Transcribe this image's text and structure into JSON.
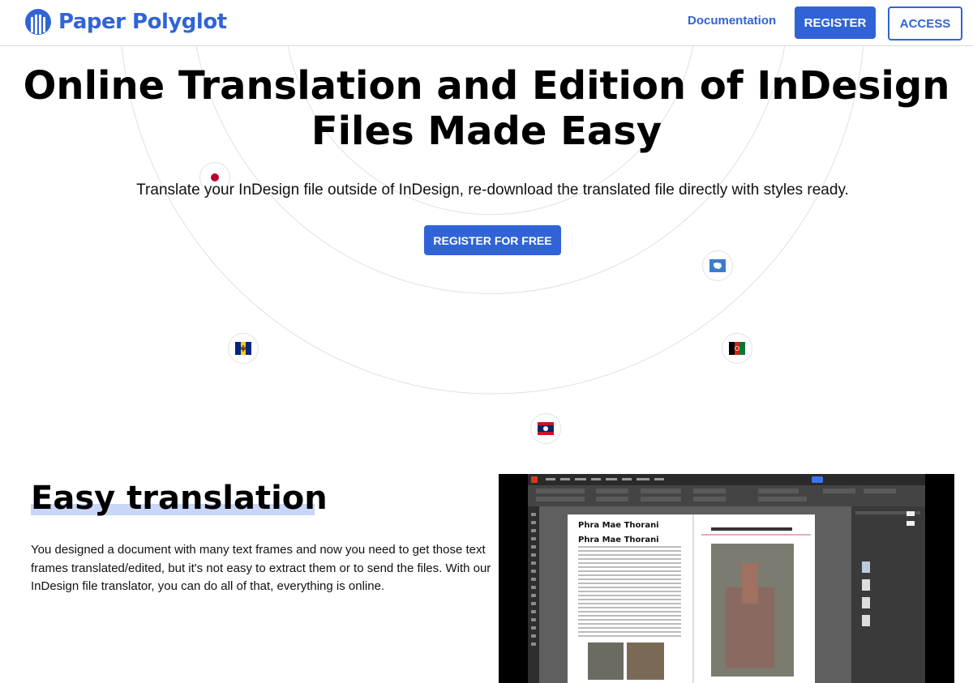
{
  "brand": {
    "name": "Paper Polyglot",
    "color": "#3064d6"
  },
  "nav": {
    "documentation": "Documentation",
    "register": "REGISTER",
    "access": "ACCESS"
  },
  "hero": {
    "title_line1": "Online Translation and Edition of InDesign",
    "title_line2": "Files Made Easy",
    "subtitle": "Translate your InDesign file outside of InDesign, re-download the translated file directly with styles ready.",
    "cta": "REGISTER FOR FREE"
  },
  "flags": [
    "japan",
    "antarctica",
    "barbados",
    "afghanistan",
    "laos"
  ],
  "section": {
    "title": "Easy translation",
    "body": "You designed a document with many text frames and now you need to get those text frames translated/edited, but it's not easy to extract them or to send the files. With our InDesign file translator, you can do all of that, everything is online."
  },
  "screenshot": {
    "heading": "Phra Mae Thorani",
    "tab": "template.indd @ 50%"
  }
}
